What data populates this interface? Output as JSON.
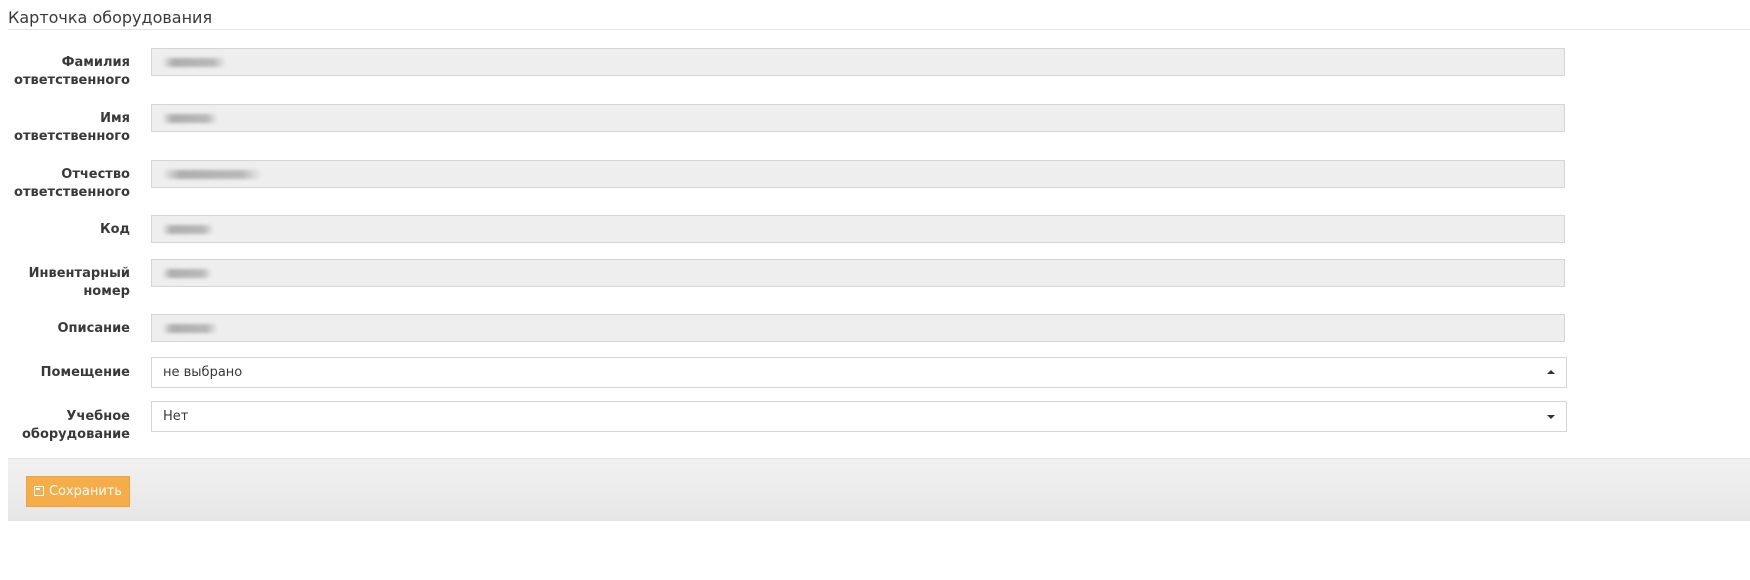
{
  "card": {
    "title": "Карточка оборудования"
  },
  "fields": {
    "surname": {
      "label_line1": "Фамилия",
      "label_line2": "ответственного"
    },
    "firstname": {
      "label_line1": "Имя",
      "label_line2": "ответственного"
    },
    "patronymic": {
      "label_line1": "Отчество",
      "label_line2": "ответственного"
    },
    "code": {
      "label": "Код"
    },
    "inventory": {
      "label_line1": "Инвентарный",
      "label_line2": "номер"
    },
    "description": {
      "label": "Описание"
    },
    "room": {
      "label": "Помещение",
      "value": "не выбрано"
    },
    "educational": {
      "label_line1": "Учебное",
      "label_line2": "оборудование",
      "value": "Нет"
    }
  },
  "actions": {
    "save_label": "Сохранить"
  },
  "colors": {
    "accent": "#f4ad49",
    "readonly_bg": "#eeeeee"
  }
}
